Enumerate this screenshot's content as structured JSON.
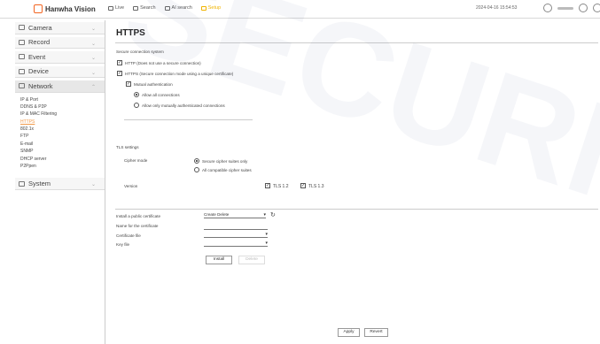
{
  "header": {
    "brand": "Hanwha Vision",
    "nav": [
      {
        "label": "Live"
      },
      {
        "label": "Search"
      },
      {
        "label": "AI search"
      },
      {
        "label": "Setup"
      }
    ],
    "datetime": "2024-04-16 15:54:53"
  },
  "sidebar": {
    "menus": [
      {
        "label": "Camera"
      },
      {
        "label": "Record"
      },
      {
        "label": "Event"
      },
      {
        "label": "Device"
      },
      {
        "label": "Network"
      }
    ],
    "network_items": [
      "IP & Port",
      "DDNS & P2P",
      "IP & MAC Filtering",
      "HTTPS",
      "802.1x",
      "FTP",
      "E-mail",
      "SNMP",
      "DHCP server",
      "P2Ppen"
    ],
    "system": "System"
  },
  "page": {
    "title": "HTTPS",
    "secure_system_label": "Secure connection system",
    "opt_no_secure": "HTTP (Does not use a secure connection)",
    "opt_https": "HTTPS (Secure connection mode using a unique certificate)",
    "mutual_auth": "Mutual authentication",
    "allow_all": "Allow all connections",
    "allow_mutual": "Allow only mutually authenticated connections",
    "tls_label": "TLS settings",
    "cipher_mode_label": "Cipher mode",
    "cipher_secure": "Secure cipher suites only",
    "cipher_all": "All compatible cipher suites",
    "version_label": "Version",
    "tls12": "TLS 1.2",
    "tls13": "TLS 1.3",
    "install_cert_label": "Install a public certificate",
    "install_cert_value": "Create Delete",
    "cert_name_label": "Name for the certificate",
    "cert_file_label": "Certificate file",
    "key_file_label": "Key file",
    "install_btn": "Install",
    "delete_btn": "Delete",
    "apply_btn": "Apply",
    "revert_btn": "Revert"
  },
  "watermark": "SECURITY"
}
